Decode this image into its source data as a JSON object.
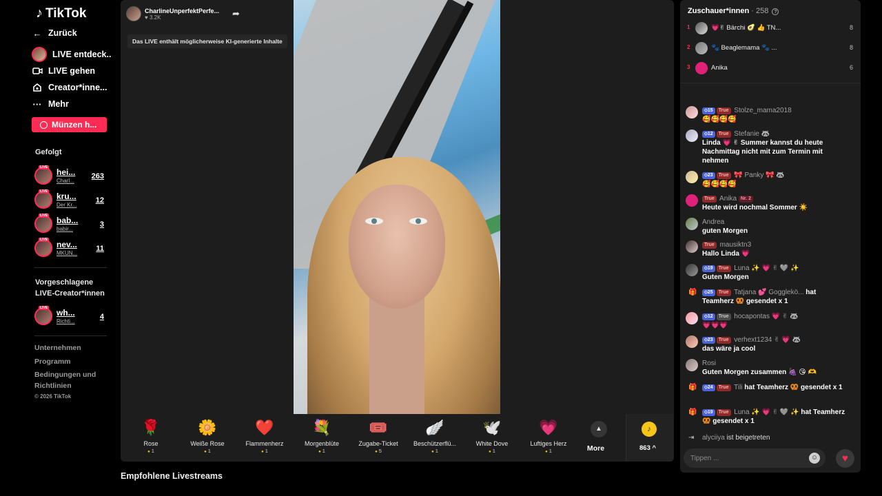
{
  "sidebar": {
    "logo": "TikTok",
    "back": "Zurück",
    "nav": [
      {
        "label": "LIVE entdeck..",
        "icon": "live-avatar-icon"
      },
      {
        "label": "LIVE gehen",
        "icon": "camera-icon"
      },
      {
        "label": "Creator*inne...",
        "icon": "creator-home-icon"
      },
      {
        "label": "Mehr",
        "icon": "more-dots-icon"
      }
    ],
    "coins_button": "Münzen h...",
    "followed_title": "Gefolgt",
    "live_tag": "LIVE",
    "followed": [
      {
        "name": "hei...",
        "sub": "Charl...",
        "count": "263"
      },
      {
        "name": "kru...",
        "sub": "Der Kr...",
        "count": "12"
      },
      {
        "name": "bab...",
        "sub": "babir...",
        "count": "3"
      },
      {
        "name": "nev...",
        "sub": "MKUN...",
        "count": "11"
      }
    ],
    "suggested_title": "Vorgeschlagene LIVE-Creator*innen",
    "suggested": [
      {
        "name": "wh...",
        "sub": "Richti...",
        "count": "4"
      }
    ],
    "footer_links": [
      "Unternehmen",
      "Programm",
      "Bedingungen und Richtlinien"
    ],
    "copyright": "© 2026 TikTok"
  },
  "stream": {
    "host_name": "CharlineUnperfektPerfe...",
    "host_likes": "3.2K",
    "ai_notice": "Das LIVE enthält möglicherweise KI-generierte Inhalte",
    "gifts": [
      {
        "name": "Rose",
        "price": "1",
        "icon": "rose-icon",
        "glyph": "🌹"
      },
      {
        "name": "Weiße Rose",
        "price": "1",
        "icon": "white-rose-icon",
        "glyph": "🌼"
      },
      {
        "name": "Flammenherz",
        "price": "1",
        "icon": "flame-heart-icon",
        "glyph": "❤️"
      },
      {
        "name": "Morgenblüte",
        "price": "1",
        "icon": "bouquet-icon",
        "glyph": "💐"
      },
      {
        "name": "Zugabe-Ticket",
        "price": "5",
        "icon": "ticket-icon",
        "glyph": "🎟️"
      },
      {
        "name": "Beschützerflü...",
        "price": "1",
        "icon": "wings-icon",
        "glyph": "🪽"
      },
      {
        "name": "White Dove",
        "price": "1",
        "icon": "dove-icon",
        "glyph": "🕊️"
      },
      {
        "name": "Luftiges Herz",
        "price": "1",
        "icon": "pink-heart-icon",
        "glyph": "💗"
      }
    ],
    "more_label": "More",
    "coins_balance": "863"
  },
  "recommended_title": "Empfohlene Livestreams",
  "chat": {
    "viewers_label": "Zuschauer*innen",
    "viewers_count": "258",
    "top_viewers": [
      {
        "rank": "1",
        "name": "💗✌ Bärchi 🥑 👍 TN...",
        "score": "8"
      },
      {
        "rank": "2",
        "name": "🐾 Beaglemama 🐾 ...",
        "score": "8"
      },
      {
        "rank": "3",
        "name": "Anika",
        "score": "6"
      }
    ],
    "messages": [
      {
        "level": "15",
        "true": "True",
        "user": "Stolze_mama2018",
        "text": "🥰🥰🥰🥰"
      },
      {
        "level": "12",
        "true": "True",
        "user": "Stefanie 🦝",
        "text": "Linda 💗 ✌ Summer kannst du heute Nachmittag nicht mit zum Termin mit nehmen"
      },
      {
        "level": "23",
        "true": "True",
        "user": "🎀 Panky 🎀 🦝",
        "text": "🥰🥰🥰🥰"
      },
      {
        "true": "True",
        "user": "Anika",
        "nr": "Nr. 2",
        "text": "Heute wird nochmal Sommer ☀️"
      },
      {
        "user": "Andrea",
        "text": "guten Morgen"
      },
      {
        "true": "True",
        "user": "mausiktn3",
        "text": "Hallo Linda 💗"
      },
      {
        "level": "19",
        "true": "True",
        "user": "Luna ✨ 💗 ✌ 🩶 ✨",
        "text": "Guten Morgen"
      },
      {
        "level": "25",
        "true": "True",
        "user": "Tatjana 💕 Gogglekö...",
        "text": "hat Teamherz 🥨 gesendet x 1"
      },
      {
        "level": "12",
        "true": "True",
        "user": "hocapontas 💗 ✌ 🦝",
        "text": "💗💗💗"
      },
      {
        "level": "23",
        "true": "True",
        "user": "verhext1234 ✌ 💗 🦝",
        "text": "das wäre ja cool"
      },
      {
        "user": "Rosi",
        "text": "Guten Morgen zusammen 🍇 😘 🫶"
      },
      {
        "level": "24",
        "true": "True",
        "user": "Tili",
        "text": "hat Teamherz 🥨 gesendet x 1"
      },
      {
        "level": "19",
        "true": "True",
        "user": "Luna ✨ 💗 ✌ 🩶 ✨",
        "text": "hat Teamherz 🥨 gesendet x 1"
      },
      {
        "user": "alyciiya",
        "text": "ist beigetreten"
      }
    ],
    "input_placeholder": "Tippen ..."
  },
  "colors": {
    "accent": "#fe2c55",
    "panel": "#1d1d1d",
    "coin": "#f5c518",
    "level_badge": "#4a63d9"
  }
}
